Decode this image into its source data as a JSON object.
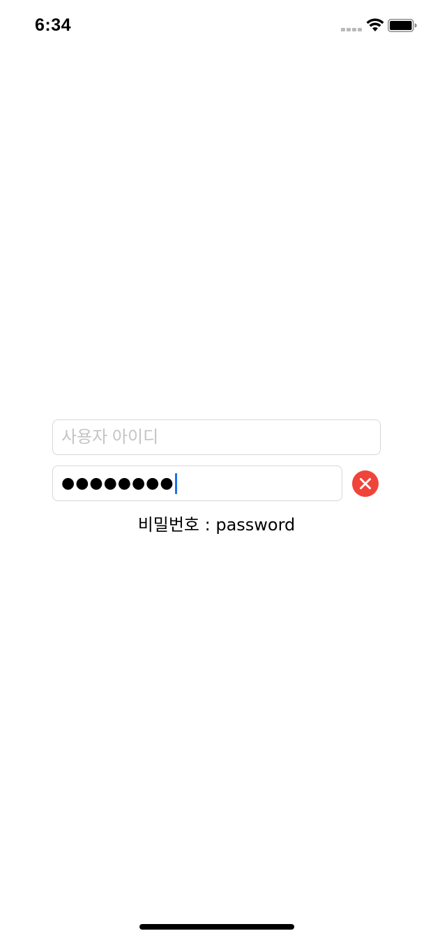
{
  "status_bar": {
    "time": "6:34",
    "signal_icon": "cellular-signal-icon",
    "wifi_icon": "wifi-icon",
    "battery_icon": "battery-icon"
  },
  "login": {
    "user_id": {
      "value": "",
      "placeholder": "사용자 아이디"
    },
    "password": {
      "masked_value": "●●●●●●●●",
      "clear_icon": "clear-icon"
    },
    "hint": "비밀번호 : password"
  },
  "colors": {
    "clear_button": "#f0443a",
    "caret": "#1a73e8",
    "field_border": "#d6d6d6",
    "placeholder": "#c4c4c6"
  }
}
